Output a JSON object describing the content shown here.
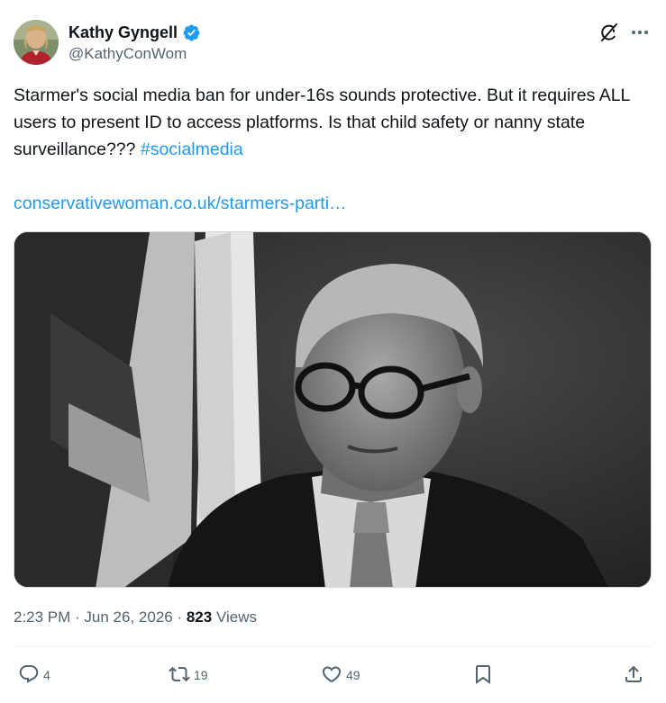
{
  "author": {
    "display_name": "Kathy Gyngell",
    "handle": "@KathyConWom",
    "verified": true
  },
  "icons": {
    "grok": "grok-icon",
    "more": "more-icon",
    "verified": "verified-badge-icon",
    "reply": "reply-icon",
    "retweet": "retweet-icon",
    "like": "like-icon",
    "bookmark": "bookmark-icon",
    "share": "share-icon"
  },
  "tweet": {
    "text": "Starmer's social media ban for under-16s sounds protective.  But it requires ALL users to present ID to access platforms. Is that child safety or nanny state surveillance??? ",
    "hashtag": "#socialmedia",
    "link": "conservativewoman.co.uk/starmers-parti…",
    "time": "2:23 PM",
    "separator": " · ",
    "date": "Jun 26, 2026",
    "separator2": " · ",
    "views_count": "823",
    "views_label": " Views"
  },
  "actions": {
    "reply_count": "4",
    "retweet_count": "19",
    "like_count": "49"
  },
  "colors": {
    "accent": "#1d9bf0",
    "text": "#0f1419",
    "secondary": "#536471",
    "verified": "#1d9bf0"
  }
}
